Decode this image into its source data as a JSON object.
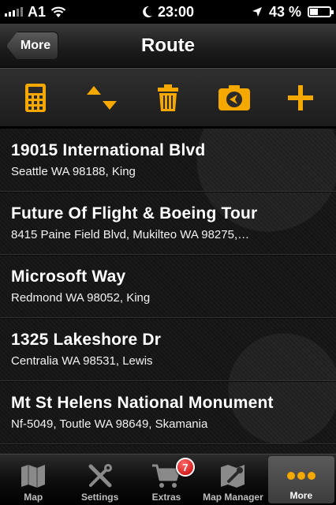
{
  "status_bar": {
    "carrier": "A1",
    "time": "23:00",
    "battery": "43 %",
    "battery_level": 0.43
  },
  "header": {
    "back_label": "More",
    "title": "Route"
  },
  "toolbar": {
    "accent_color": "#f5a800",
    "icons": [
      "calculator-icon",
      "sort-arrows-icon",
      "trash-icon",
      "camera-nav-icon",
      "plus-icon"
    ]
  },
  "route_items": [
    {
      "title": "19015 International Blvd",
      "subtitle": "Seattle WA 98188, King"
    },
    {
      "title": "Future Of Flight & Boeing Tour",
      "subtitle": "8415 Paine Field Blvd, Mukilteo WA 98275,…"
    },
    {
      "title": "Microsoft Way",
      "subtitle": "Redmond WA 98052, King"
    },
    {
      "title": "1325 Lakeshore Dr",
      "subtitle": "Centralia WA 98531, Lewis"
    },
    {
      "title": "Mt St Helens National Monument",
      "subtitle": "Nf-5049, Toutle WA 98649, Skamania"
    }
  ],
  "tabbar": {
    "tabs": [
      {
        "label": "Map",
        "icon": "map-icon"
      },
      {
        "label": "Settings",
        "icon": "tools-icon"
      },
      {
        "label": "Extras",
        "icon": "cart-icon",
        "badge": "7"
      },
      {
        "label": "Map Manager",
        "icon": "map-manager-icon"
      },
      {
        "label": "More",
        "icon": "more-dots-icon",
        "active": true
      }
    ]
  }
}
